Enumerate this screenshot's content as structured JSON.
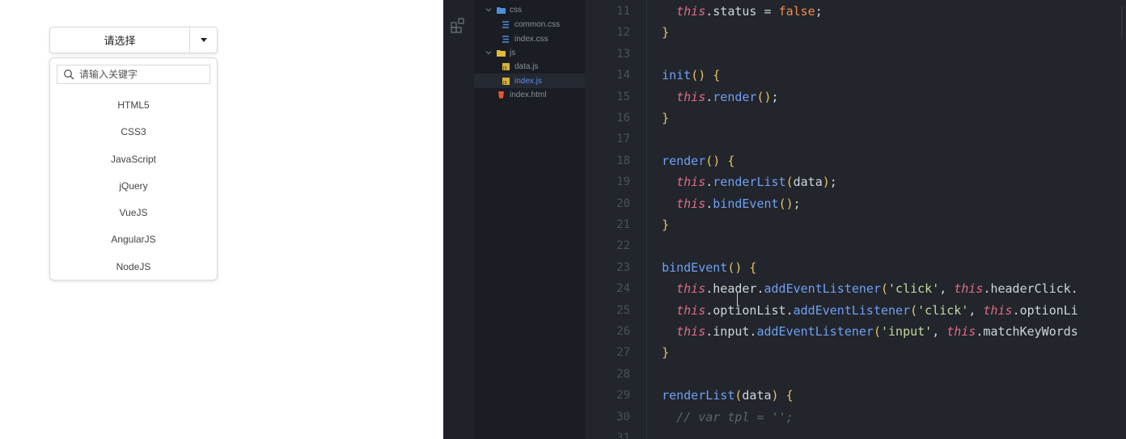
{
  "select": {
    "value": "请选择",
    "search_placeholder": "请输入关键字",
    "options": [
      "HTML5",
      "CSS3",
      "JavaScript",
      "jQuery",
      "VueJS",
      "AngularJS",
      "NodeJS"
    ]
  },
  "explorer": {
    "items": [
      {
        "name": "css",
        "type": "folder",
        "icon": "folder-icon"
      },
      {
        "name": "common.css",
        "type": "css",
        "icon": "css-file-icon"
      },
      {
        "name": "index.css",
        "type": "css",
        "icon": "css-file-icon"
      },
      {
        "name": "js",
        "type": "folder",
        "icon": "folder-open-icon"
      },
      {
        "name": "data.js",
        "type": "js",
        "icon": "js-file-icon"
      },
      {
        "name": "index.js",
        "type": "js",
        "icon": "js-file-icon",
        "active": true
      },
      {
        "name": "index.html",
        "type": "html",
        "icon": "html-file-icon"
      }
    ]
  },
  "editor": {
    "line_numbers": [
      "11",
      "12",
      "13",
      "14",
      "15",
      "16",
      "17",
      "18",
      "19",
      "20",
      "21",
      "22",
      "23",
      "24",
      "25",
      "26",
      "27",
      "28",
      "29",
      "30",
      "31"
    ],
    "lines": [
      [
        [
          "    ",
          "plain"
        ],
        [
          "this",
          "kw"
        ],
        [
          ".status = ",
          "plain"
        ],
        [
          "false",
          "bool"
        ],
        [
          ";",
          "plain"
        ]
      ],
      [
        [
          "  ",
          "plain"
        ],
        [
          "}",
          "pn"
        ]
      ],
      [],
      [
        [
          "  ",
          "plain"
        ],
        [
          "init",
          "fn"
        ],
        [
          "() {",
          "pn"
        ]
      ],
      [
        [
          "    ",
          "plain"
        ],
        [
          "this",
          "kw"
        ],
        [
          ".",
          "plain"
        ],
        [
          "render",
          "fn"
        ],
        [
          "()",
          "pn"
        ],
        [
          ";",
          "plain"
        ]
      ],
      [
        [
          "  ",
          "plain"
        ],
        [
          "}",
          "pn"
        ]
      ],
      [],
      [
        [
          "  ",
          "plain"
        ],
        [
          "render",
          "fn"
        ],
        [
          "() {",
          "pn"
        ]
      ],
      [
        [
          "    ",
          "plain"
        ],
        [
          "this",
          "kw"
        ],
        [
          ".",
          "plain"
        ],
        [
          "renderList",
          "fn"
        ],
        [
          "(",
          "pn"
        ],
        [
          "data",
          "plain"
        ],
        [
          ")",
          "pn"
        ],
        [
          ";",
          "plain"
        ]
      ],
      [
        [
          "    ",
          "plain"
        ],
        [
          "this",
          "kw"
        ],
        [
          ".",
          "plain"
        ],
        [
          "bindEvent",
          "fn"
        ],
        [
          "()",
          "pn"
        ],
        [
          ";",
          "plain"
        ]
      ],
      [
        [
          "  ",
          "plain"
        ],
        [
          "}",
          "pn"
        ]
      ],
      [],
      [
        [
          "  ",
          "plain"
        ],
        [
          "bindEvent",
          "fn"
        ],
        [
          "() {",
          "pn"
        ]
      ],
      [
        [
          "    ",
          "plain"
        ],
        [
          "this",
          "kw"
        ],
        [
          ".header.",
          "plain"
        ],
        [
          "addEventListener",
          "fn"
        ],
        [
          "(",
          "pn"
        ],
        [
          "'click'",
          "str"
        ],
        [
          ", ",
          "plain"
        ],
        [
          "this",
          "kw"
        ],
        [
          ".headerClick.",
          "plain"
        ]
      ],
      [
        [
          "    ",
          "plain"
        ],
        [
          "this",
          "kw"
        ],
        [
          ".optionList.",
          "plain"
        ],
        [
          "addEventListener",
          "fn"
        ],
        [
          "(",
          "pn"
        ],
        [
          "'click'",
          "str"
        ],
        [
          ", ",
          "plain"
        ],
        [
          "this",
          "kw"
        ],
        [
          ".optionLi",
          "plain"
        ]
      ],
      [
        [
          "    ",
          "plain"
        ],
        [
          "this",
          "kw"
        ],
        [
          ".input.",
          "plain"
        ],
        [
          "addEventListener",
          "fn"
        ],
        [
          "(",
          "pn"
        ],
        [
          "'input'",
          "str"
        ],
        [
          ", ",
          "plain"
        ],
        [
          "this",
          "kw"
        ],
        [
          ".matchKeyWords",
          "plain"
        ]
      ],
      [
        [
          "  ",
          "plain"
        ],
        [
          "}",
          "pn"
        ]
      ],
      [],
      [
        [
          "  ",
          "plain"
        ],
        [
          "renderList",
          "fn"
        ],
        [
          "(",
          "pn"
        ],
        [
          "data",
          "plain"
        ],
        [
          ") {",
          "pn"
        ]
      ],
      [
        [
          "    ",
          "plain"
        ],
        [
          "// var tpl = '';",
          "cm"
        ]
      ],
      []
    ]
  },
  "colors": {
    "editor_bg": "#22252c",
    "sidebar_bg": "#1a1d23",
    "keyword": "#e06c85",
    "function": "#6fa0f2",
    "punctuation": "#e8c466",
    "string": "#c5d99c",
    "boolean": "#f08a4b",
    "active_file": "#5b8de8"
  }
}
